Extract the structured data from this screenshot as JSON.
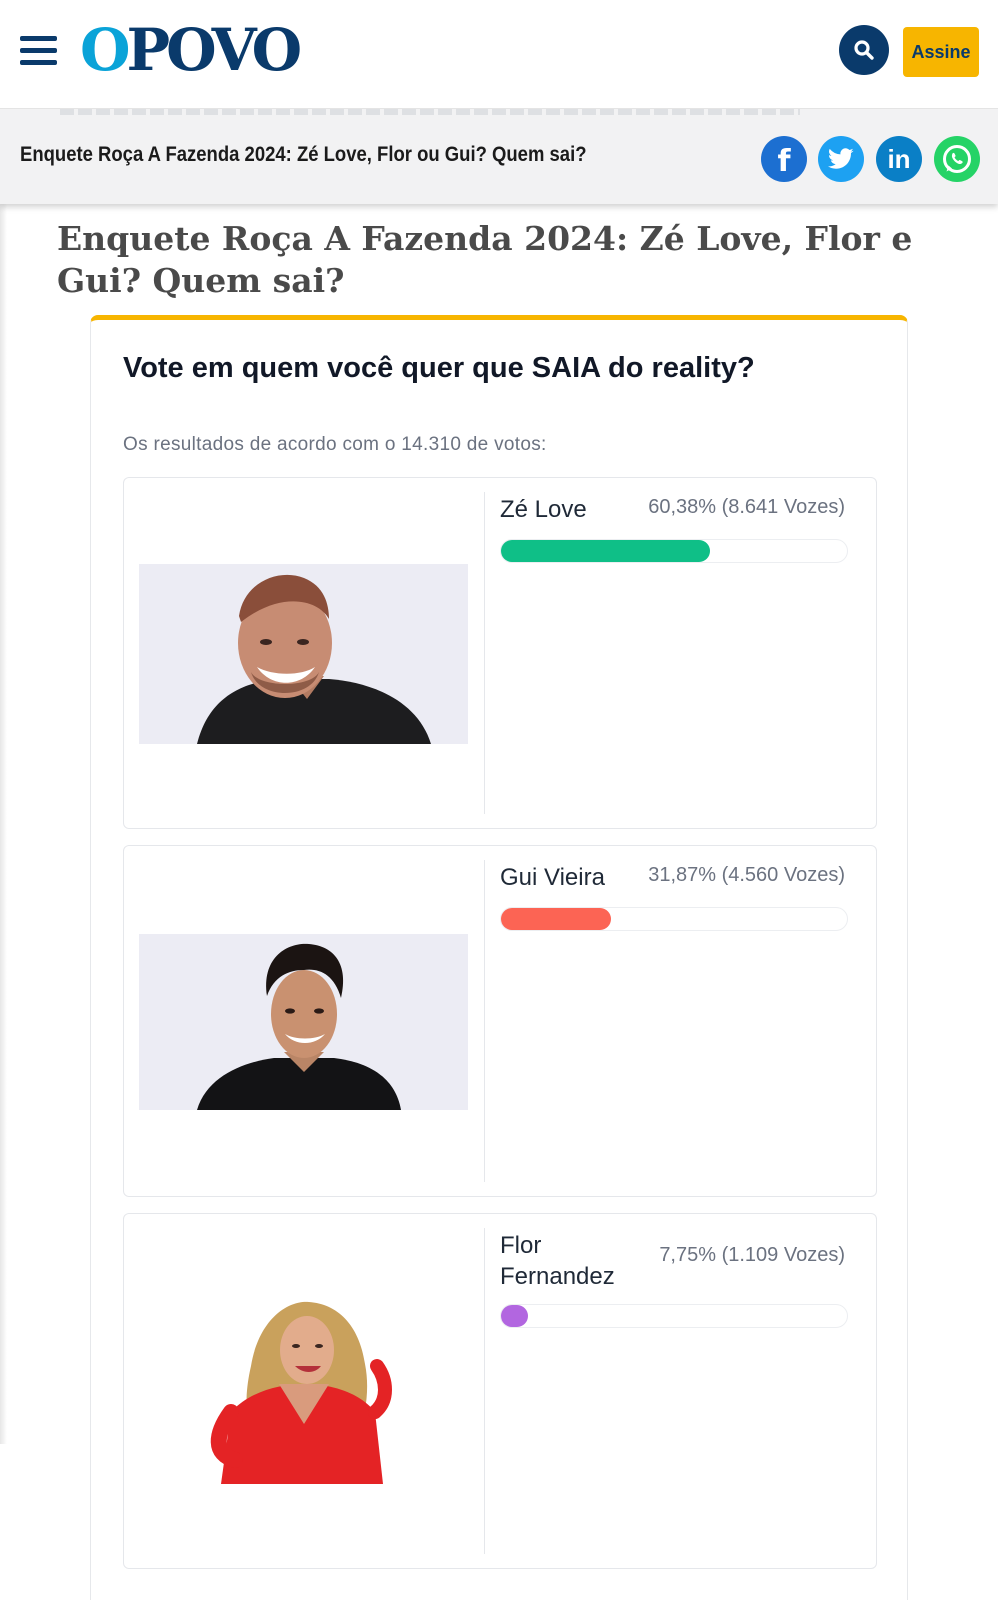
{
  "header": {
    "logo_text_first": "O",
    "logo_text_rest": "POVO",
    "subscribe_label": "Assine",
    "colors": {
      "navy": "#0a3a6b",
      "cyan": "#0aa3d8",
      "yellow": "#f7b500"
    }
  },
  "share_bar": {
    "title": "Enquete Roça A Fazenda 2024: Zé Love, Flor ou Gui? Quem sai?",
    "networks": [
      {
        "name": "facebook-icon",
        "glyph": "f"
      },
      {
        "name": "twitter-icon",
        "glyph": "🐦"
      },
      {
        "name": "linkedin-icon",
        "glyph": "in"
      },
      {
        "name": "whatsapp-icon",
        "glyph": "✆"
      }
    ]
  },
  "article": {
    "headline": "Enquete Roça A Fazenda 2024: Zé Love, Flor e Gui? Quem sai?"
  },
  "poll": {
    "question": "Vote em quem você quer que SAIA do reality?",
    "results_text": "Os resultados de acordo com o 14.310 de votos:",
    "options": [
      {
        "name": "Zé Love",
        "result": "60,38% (8.641 Vozes)",
        "percent": 60.38,
        "color": "#0fbf87"
      },
      {
        "name": "Gui Vieira",
        "result": "31,87% (4.560 Vozes)",
        "percent": 31.87,
        "color": "#fc6454"
      },
      {
        "name": "Flor Fernandez",
        "result": "7,75% (1.109 Vozes)",
        "percent": 7.75,
        "color": "#b266e0"
      }
    ]
  }
}
